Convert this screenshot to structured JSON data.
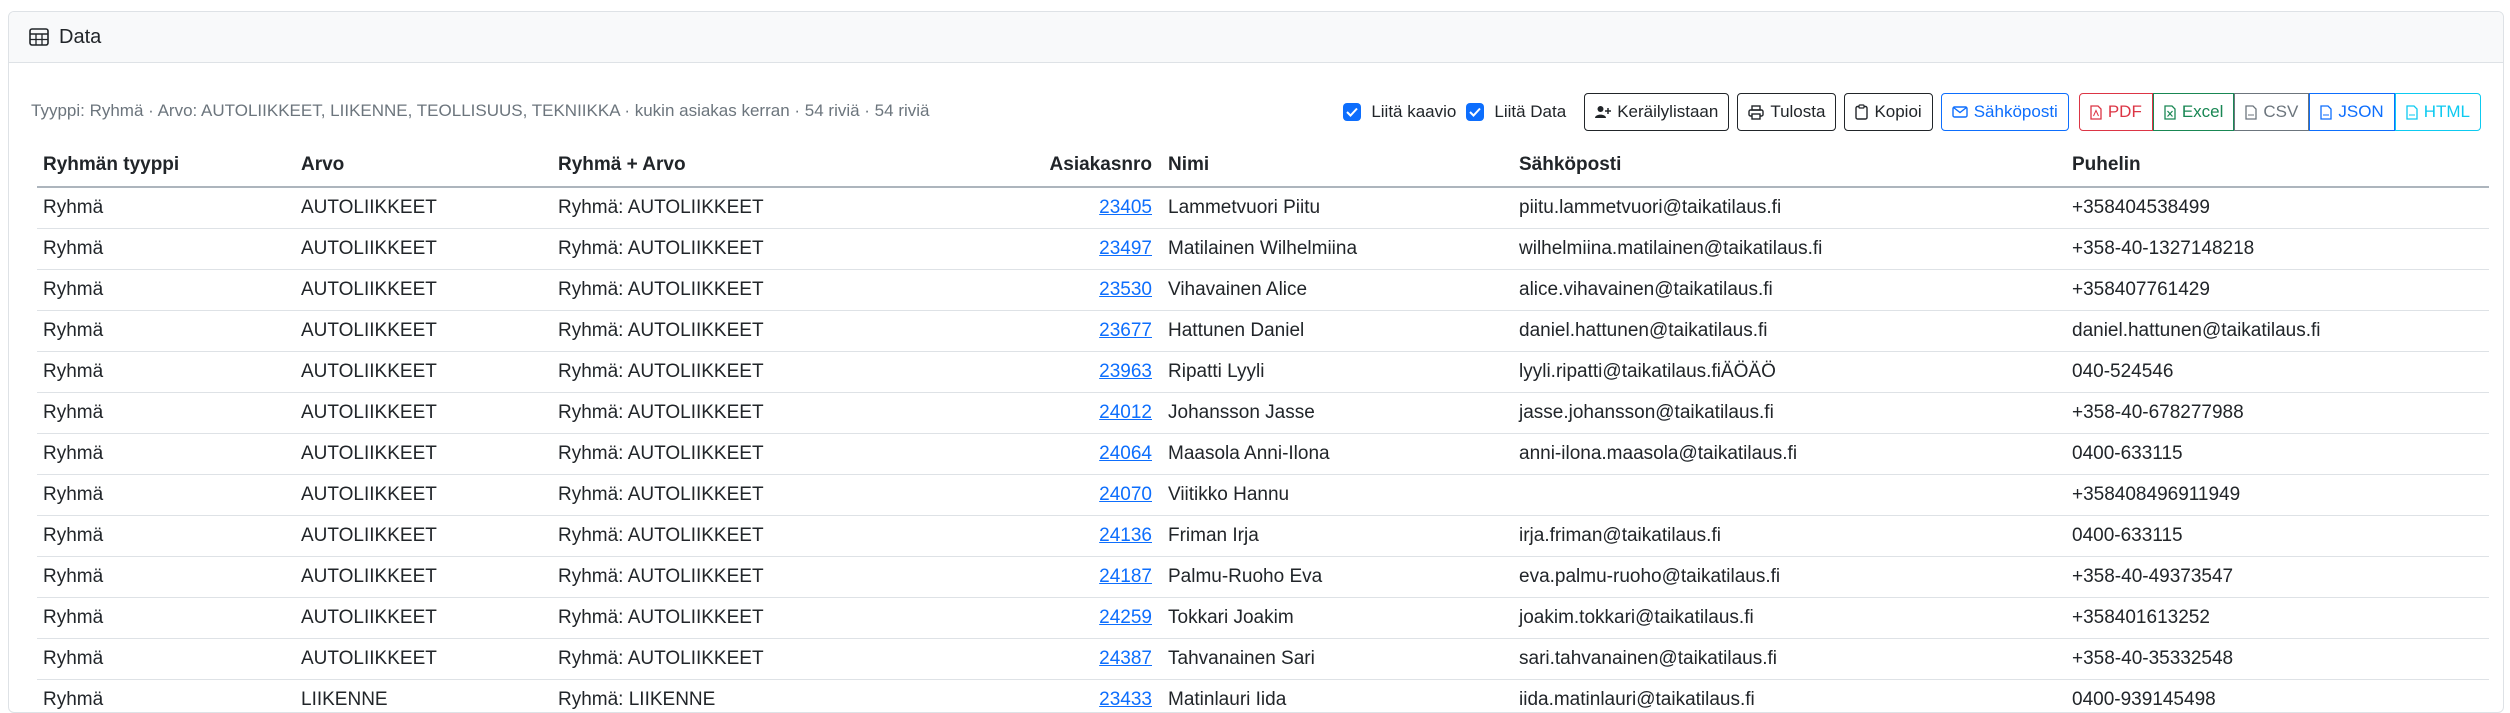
{
  "header": {
    "title": "Data"
  },
  "summary": "Tyyppi: Ryhmä · Arvo: AUTOLIIKKEET, LIIKENNE, TEOLLISUUS, TEKNIIKKA · kukin asiakas kerran · 54 riviä · 54 riviä",
  "toolbar": {
    "attach_chart_label": "Liitä kaavio",
    "attach_data_label": "Liitä Data",
    "picklist_label": "Keräilylistaan",
    "print_label": "Tulosta",
    "copy_label": "Kopioi",
    "email_label": "Sähköposti",
    "pdf_label": "PDF",
    "excel_label": "Excel",
    "csv_label": "CSV",
    "json_label": "JSON",
    "html_label": "HTML"
  },
  "table": {
    "columns": [
      "Ryhmän tyyppi",
      "Arvo",
      "Ryhmä + Arvo",
      "Asiakasnro",
      "Nimi",
      "Sähköposti",
      "Puhelin"
    ],
    "rows": [
      [
        "Ryhmä",
        "AUTOLIIKKEET",
        "Ryhmä: AUTOLIIKKEET",
        "23405",
        "Lammetvuori Piitu",
        "piitu.lammetvuori@taikatilaus.fi",
        "+358404538499"
      ],
      [
        "Ryhmä",
        "AUTOLIIKKEET",
        "Ryhmä: AUTOLIIKKEET",
        "23497",
        "Matilainen Wilhelmiina",
        "wilhelmiina.matilainen@taikatilaus.fi",
        "+358-40-1327148218"
      ],
      [
        "Ryhmä",
        "AUTOLIIKKEET",
        "Ryhmä: AUTOLIIKKEET",
        "23530",
        "Vihavainen Alice",
        "alice.vihavainen@taikatilaus.fi",
        "+358407761429"
      ],
      [
        "Ryhmä",
        "AUTOLIIKKEET",
        "Ryhmä: AUTOLIIKKEET",
        "23677",
        "Hattunen Daniel",
        "daniel.hattunen@taikatilaus.fi",
        "daniel.hattunen@taikatilaus.fi"
      ],
      [
        "Ryhmä",
        "AUTOLIIKKEET",
        "Ryhmä: AUTOLIIKKEET",
        "23963",
        "Ripatti Lyyli",
        "lyyli.ripatti@taikatilaus.fiÄÖÄÖ",
        "040-524546"
      ],
      [
        "Ryhmä",
        "AUTOLIIKKEET",
        "Ryhmä: AUTOLIIKKEET",
        "24012",
        "Johansson Jasse",
        "jasse.johansson@taikatilaus.fi",
        "+358-40-678277988"
      ],
      [
        "Ryhmä",
        "AUTOLIIKKEET",
        "Ryhmä: AUTOLIIKKEET",
        "24064",
        "Maasola Anni-Ilona",
        "anni-ilona.maasola@taikatilaus.fi",
        "0400-633115"
      ],
      [
        "Ryhmä",
        "AUTOLIIKKEET",
        "Ryhmä: AUTOLIIKKEET",
        "24070",
        "Viitikko Hannu",
        "",
        "+358408496911949"
      ],
      [
        "Ryhmä",
        "AUTOLIIKKEET",
        "Ryhmä: AUTOLIIKKEET",
        "24136",
        "Friman Irja",
        "irja.friman@taikatilaus.fi",
        "0400-633115"
      ],
      [
        "Ryhmä",
        "AUTOLIIKKEET",
        "Ryhmä: AUTOLIIKKEET",
        "24187",
        "Palmu-Ruoho Eva",
        "eva.palmu-ruoho@taikatilaus.fi",
        "+358-40-49373547"
      ],
      [
        "Ryhmä",
        "AUTOLIIKKEET",
        "Ryhmä: AUTOLIIKKEET",
        "24259",
        "Tokkari Joakim",
        "joakim.tokkari@taikatilaus.fi",
        "+358401613252"
      ],
      [
        "Ryhmä",
        "AUTOLIIKKEET",
        "Ryhmä: AUTOLIIKKEET",
        "24387",
        "Tahvanainen Sari",
        "sari.tahvanainen@taikatilaus.fi",
        "+358-40-35332548"
      ],
      [
        "Ryhmä",
        "LIIKENNE",
        "Ryhmä: LIIKENNE",
        "23433",
        "Matinlauri Iida",
        "iida.matinlauri@taikatilaus.fi",
        "0400-939145498"
      ]
    ]
  }
}
